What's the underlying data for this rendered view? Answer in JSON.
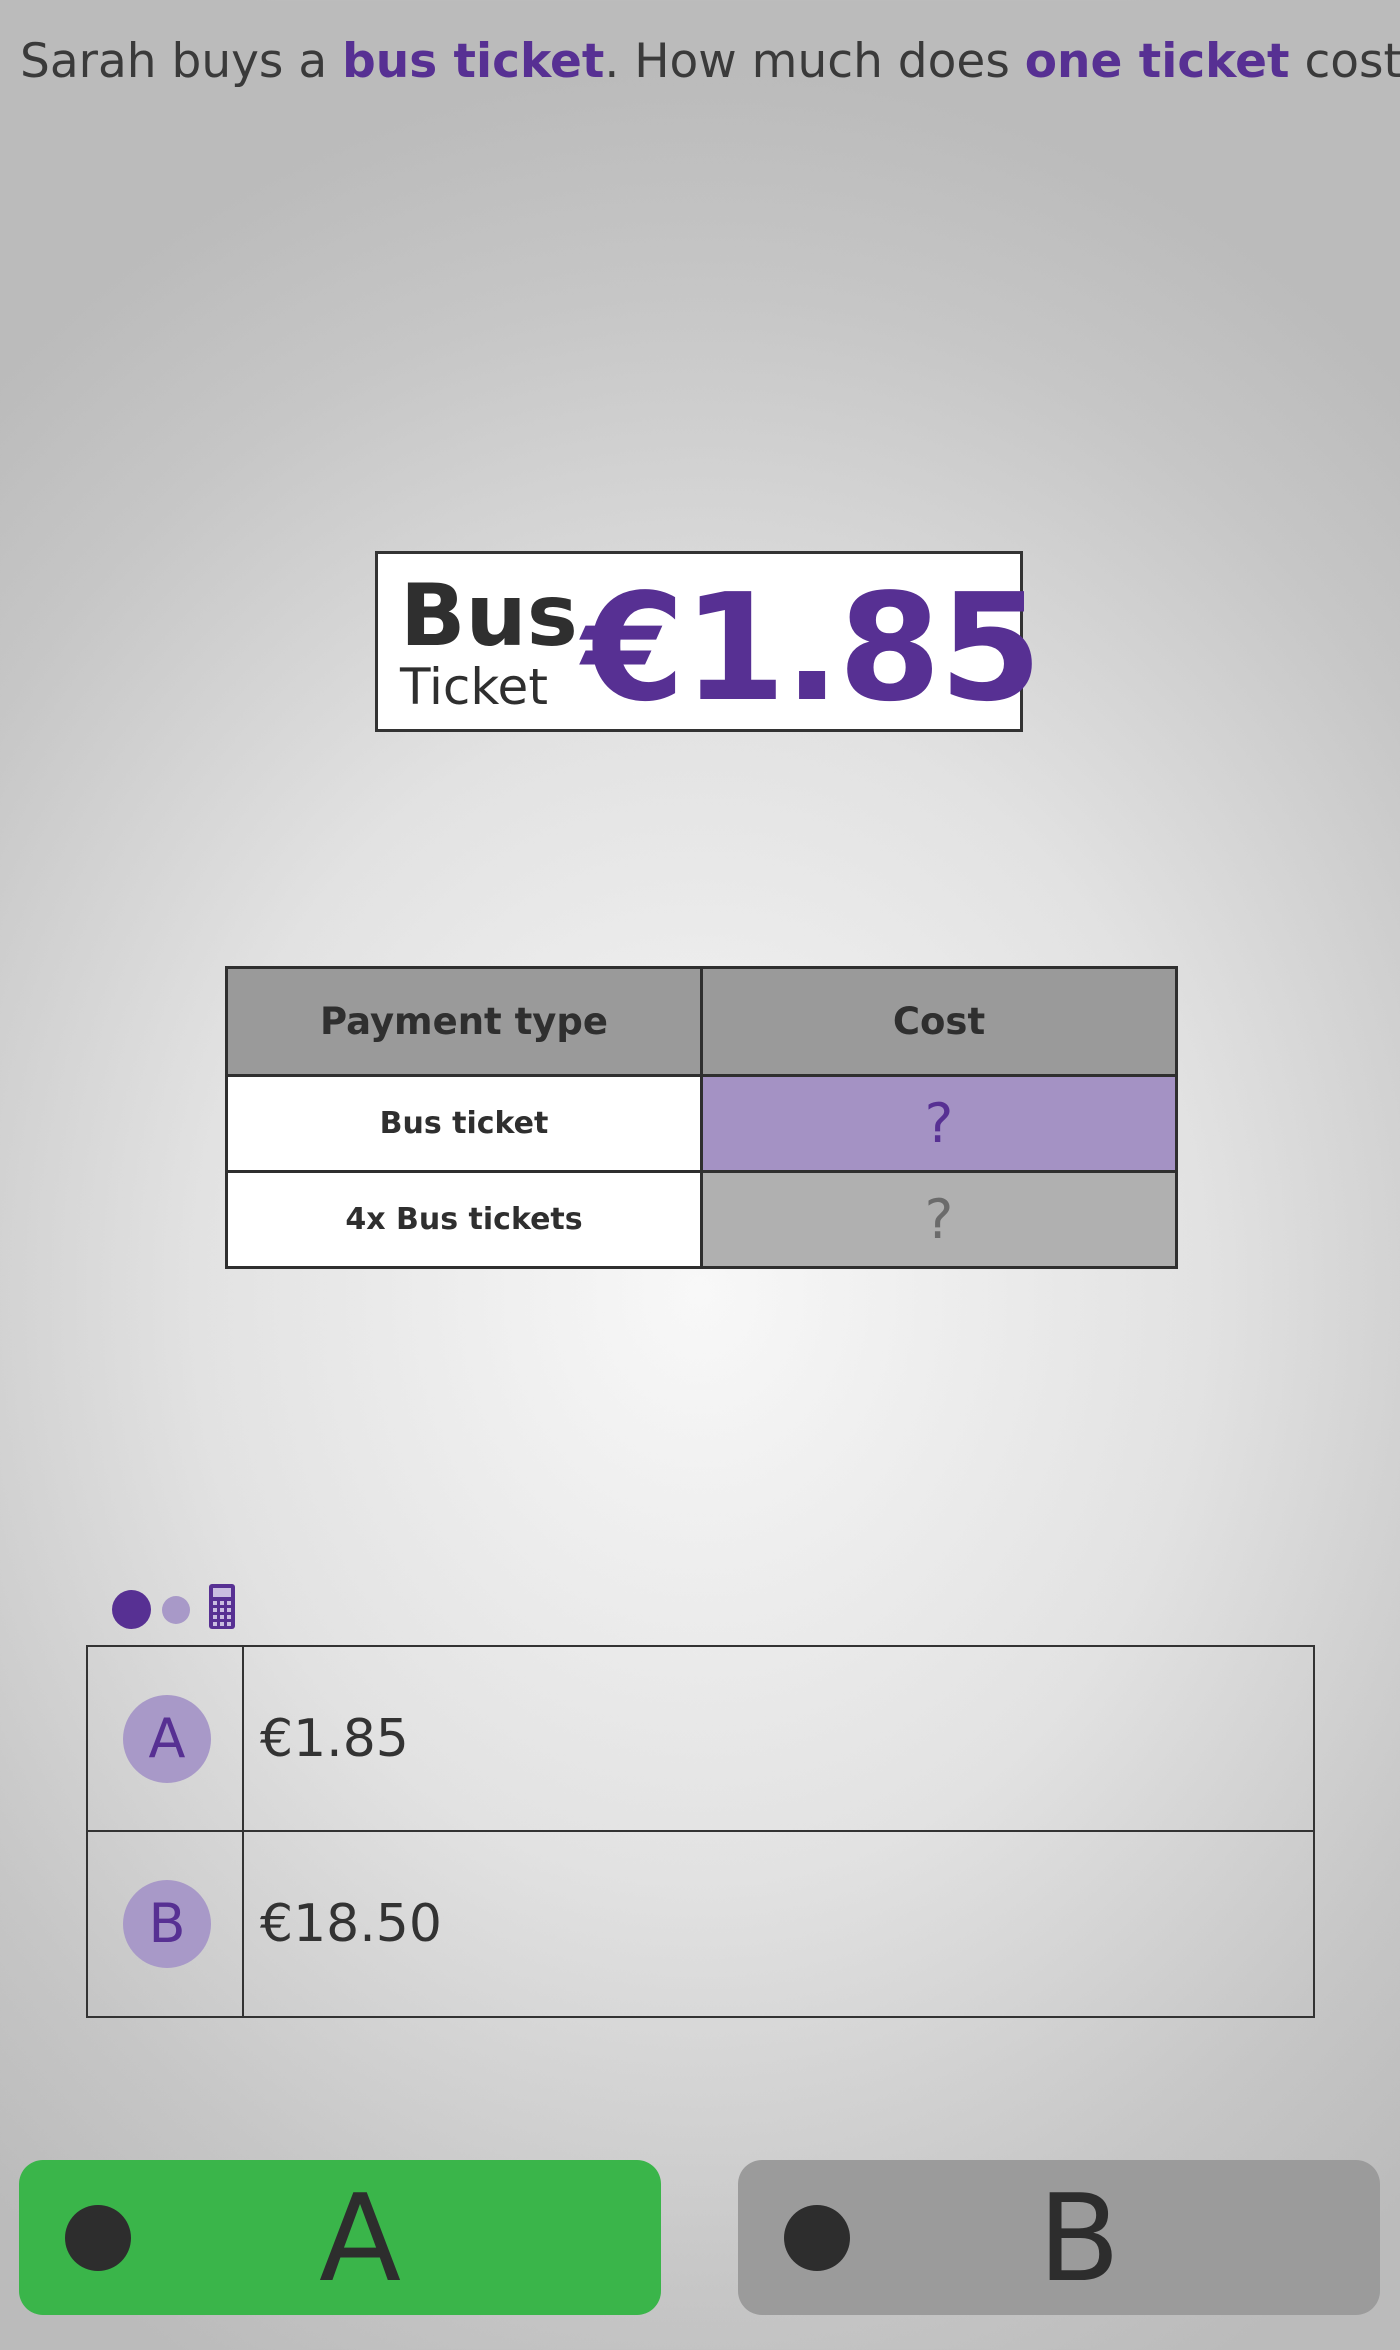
{
  "question": {
    "part1": "Sarah buys a ",
    "highlight1": "bus ticket",
    "part2": ". How much does ",
    "highlight2": "one ticket",
    "part3": " cost?"
  },
  "price_tag": {
    "title_line1": "Bus",
    "title_line2": "Ticket",
    "price": "€1.85"
  },
  "table": {
    "headers": [
      "Payment type",
      "Cost"
    ],
    "rows": [
      {
        "label": "Bus ticket",
        "cost": "?"
      },
      {
        "label": "4x Bus tickets",
        "cost": "?"
      }
    ]
  },
  "indicators": {
    "icons": [
      "filled-dot-icon",
      "light-dot-icon",
      "calculator-icon"
    ]
  },
  "options": [
    {
      "letter": "A",
      "value": "€1.85"
    },
    {
      "letter": "B",
      "value": "€18.50"
    }
  ],
  "answer_buttons": [
    {
      "label": "A",
      "selected": true,
      "color": "#3ab54a"
    },
    {
      "label": "B",
      "selected": false,
      "color": "#9b9b9b"
    }
  ],
  "colors": {
    "accent": "#573093",
    "accent_light": "#a899c8",
    "highlight_cell": "#a492c4"
  }
}
